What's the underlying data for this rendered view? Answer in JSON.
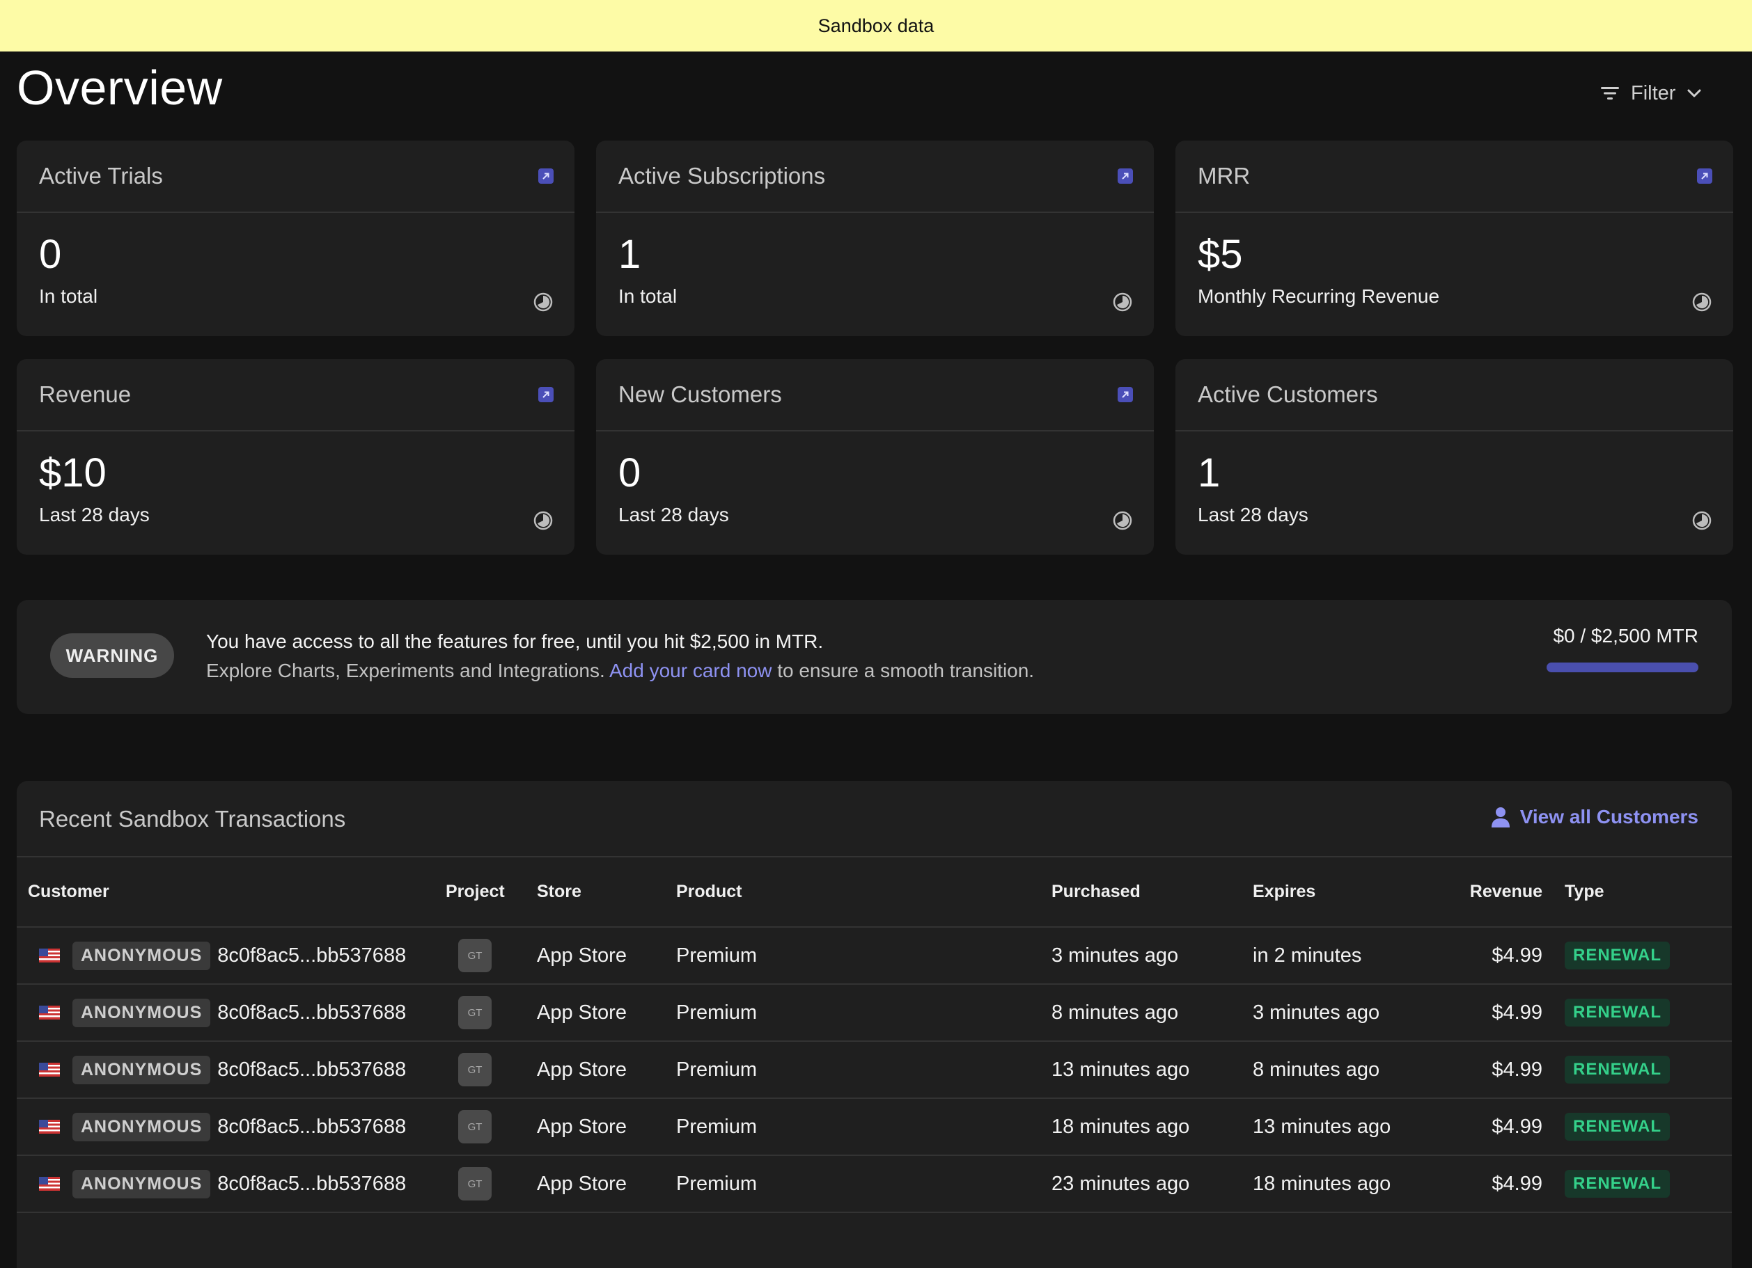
{
  "banner": {
    "text": "Sandbox data",
    "bg_color": "#fdfba6"
  },
  "page": {
    "title": "Overview"
  },
  "filter": {
    "label": "Filter",
    "icon": "filter-icon"
  },
  "cards": [
    {
      "title": "Active Trials",
      "value": "0",
      "sub": "In total",
      "has_link": true
    },
    {
      "title": "Active Subscriptions",
      "value": "1",
      "sub": "In total",
      "has_link": true
    },
    {
      "title": "MRR",
      "value": "$5",
      "sub": "Monthly Recurring Revenue",
      "has_link": true
    },
    {
      "title": "Revenue",
      "value": "$10",
      "sub": "Last 28 days",
      "has_link": true
    },
    {
      "title": "New Customers",
      "value": "0",
      "sub": "Last 28 days",
      "has_link": true
    },
    {
      "title": "Active Customers",
      "value": "1",
      "sub": "Last 28 days",
      "has_link": false
    }
  ],
  "warning": {
    "badge": "WARNING",
    "line1": "You have access to all the features for free, until you hit $2,500 in MTR.",
    "line2_pre": "Explore Charts, Experiments and Integrations. ",
    "line2_link": "Add your card now",
    "line2_post": " to ensure a smooth transition.",
    "mtr_label": "$0 / $2,500 MTR",
    "mtr_progress": 0,
    "accent_color": "#8e92f2"
  },
  "transactions": {
    "title": "Recent Sandbox Transactions",
    "view_all": "View all Customers",
    "columns": {
      "customer": "Customer",
      "project": "Project",
      "store": "Store",
      "product": "Product",
      "purchased": "Purchased",
      "expires": "Expires",
      "revenue": "Revenue",
      "type": "Type"
    },
    "rows": [
      {
        "badge": "ANONYMOUS",
        "customer_id": "8c0f8ac5...bb537688",
        "project": "GT",
        "store": "App Store",
        "product": "Premium",
        "purchased": "3 minutes ago",
        "expires": "in 2 minutes",
        "revenue": "$4.99",
        "type": "RENEWAL"
      },
      {
        "badge": "ANONYMOUS",
        "customer_id": "8c0f8ac5...bb537688",
        "project": "GT",
        "store": "App Store",
        "product": "Premium",
        "purchased": "8 minutes ago",
        "expires": "3 minutes ago",
        "revenue": "$4.99",
        "type": "RENEWAL"
      },
      {
        "badge": "ANONYMOUS",
        "customer_id": "8c0f8ac5...bb537688",
        "project": "GT",
        "store": "App Store",
        "product": "Premium",
        "purchased": "13 minutes ago",
        "expires": "8 minutes ago",
        "revenue": "$4.99",
        "type": "RENEWAL"
      },
      {
        "badge": "ANONYMOUS",
        "customer_id": "8c0f8ac5...bb537688",
        "project": "GT",
        "store": "App Store",
        "product": "Premium",
        "purchased": "18 minutes ago",
        "expires": "13 minutes ago",
        "revenue": "$4.99",
        "type": "RENEWAL"
      },
      {
        "badge": "ANONYMOUS",
        "customer_id": "8c0f8ac5...bb537688",
        "project": "GT",
        "store": "App Store",
        "product": "Premium",
        "purchased": "23 minutes ago",
        "expires": "18 minutes ago",
        "revenue": "$4.99",
        "type": "RENEWAL"
      }
    ]
  }
}
